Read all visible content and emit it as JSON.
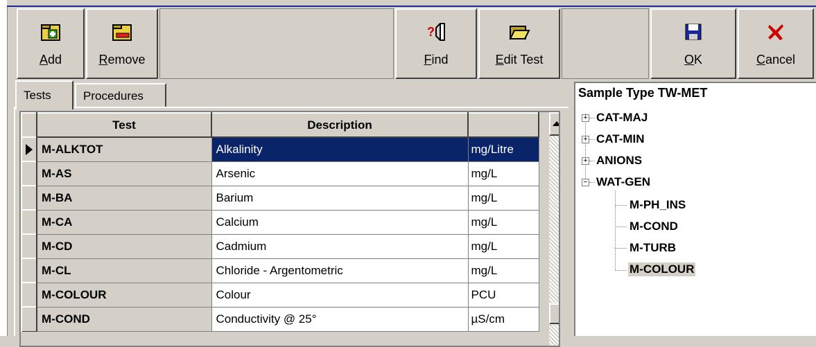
{
  "toolbar": {
    "add": {
      "pre": "",
      "key": "A",
      "post": "dd"
    },
    "remove": {
      "pre": "",
      "key": "R",
      "post": "emove"
    },
    "find": {
      "pre": "",
      "key": "F",
      "post": "ind"
    },
    "edit": {
      "pre": "",
      "key": "E",
      "post": "dit Test"
    },
    "ok": {
      "pre": "",
      "key": "O",
      "post": "K"
    },
    "cancel": {
      "pre": "",
      "key": "C",
      "post": "ancel"
    }
  },
  "tabs": [
    "Tests",
    "Procedures"
  ],
  "table": {
    "headers": [
      "Test",
      "Description",
      ""
    ],
    "rows": [
      {
        "test": "M-ALKTOT",
        "desc": "Alkalinity",
        "unit": "mg/Litre"
      },
      {
        "test": "M-AS",
        "desc": "Arsenic",
        "unit": "mg/L"
      },
      {
        "test": "M-BA",
        "desc": "Barium",
        "unit": "mg/L"
      },
      {
        "test": "M-CA",
        "desc": "Calcium",
        "unit": "mg/L"
      },
      {
        "test": "M-CD",
        "desc": "Cadmium",
        "unit": "mg/L"
      },
      {
        "test": "M-CL",
        "desc": "Chloride - Argentometric",
        "unit": "mg/L"
      },
      {
        "test": "M-COLOUR",
        "desc": "Colour",
        "unit": "PCU"
      },
      {
        "test": "M-COND",
        "desc": "Conductivity @ 25°",
        "unit": "µS/cm"
      }
    ],
    "selected_row": 0
  },
  "tree": {
    "title": "Sample Type TW-MET",
    "groups": [
      {
        "label": "CAT-MAJ",
        "sign": "+"
      },
      {
        "label": "CAT-MIN",
        "sign": "+"
      },
      {
        "label": "ANIONS",
        "sign": "+"
      },
      {
        "label": "WAT-GEN",
        "sign": "−"
      }
    ],
    "children": [
      "M-PH_INS",
      "M-COND",
      "M-TURB",
      "M-COLOUR"
    ],
    "highlighted_child": "M-COLOUR"
  },
  "icons": {
    "add": "add-folder-icon",
    "remove": "remove-folder-icon",
    "find": "find-icon",
    "edit": "open-folder-icon",
    "ok": "save-disk-icon",
    "cancel": "cancel-x-icon"
  },
  "colors": {
    "selection": "#0a246a",
    "face": "#d4d0c8",
    "cancel": "#cc0000"
  }
}
